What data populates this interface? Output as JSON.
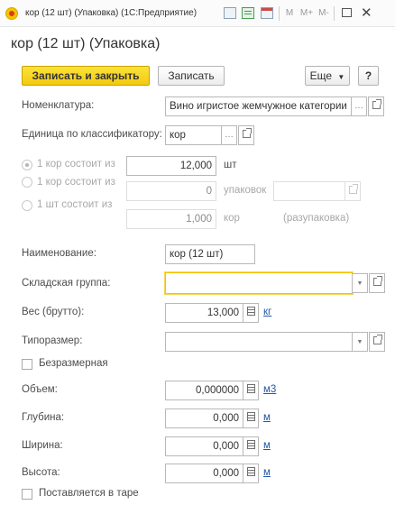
{
  "window": {
    "title": "кор (12 шт) (Упаковка)  (1С:Предприятие)",
    "controls": [
      "M",
      "M+",
      "M-"
    ]
  },
  "header": {
    "title": "кор (12 шт) (Упаковка)"
  },
  "toolbar": {
    "save_close_label": "Записать и закрыть",
    "save_label": "Записать",
    "more_label": "Еще",
    "help_label": "?"
  },
  "form": {
    "nomenclature_label": "Номенклатура:",
    "nomenclature_value": "Вино игристое жемчужное категории",
    "classifier_unit_label": "Единица по классификатору:",
    "classifier_unit_value": "кор",
    "option1_label": "1 кор состоит из",
    "option1_value": "12,000",
    "option1_unit": "шт",
    "option2_label": "1 кор состоит из",
    "option2_value": "0",
    "option2_unit": "упаковок",
    "option3_label": "1 шт состоит из",
    "option3_value": "1,000",
    "option3_unit": "кор",
    "option3_note": "(разупаковка)",
    "name_label": "Наименование:",
    "name_value": "кор (12 шт)",
    "warehouse_group_label": "Складская группа:",
    "warehouse_group_value": "",
    "weight_label": "Вес (брутто):",
    "weight_value": "13,000",
    "weight_unit": "кг",
    "size_type_label": "Типоразмер:",
    "size_type_value": "",
    "sizeless_label": "Безразмерная",
    "volume_label": "Объем:",
    "volume_value": "0,000000",
    "volume_unit": "м3",
    "depth_label": "Глубина:",
    "depth_value": "0,000",
    "depth_unit": "м",
    "width_label": "Ширина:",
    "width_value": "0,000",
    "width_unit": "м",
    "height_label": "Высота:",
    "height_value": "0,000",
    "height_unit": "м",
    "tare_label": "Поставляется в таре"
  }
}
